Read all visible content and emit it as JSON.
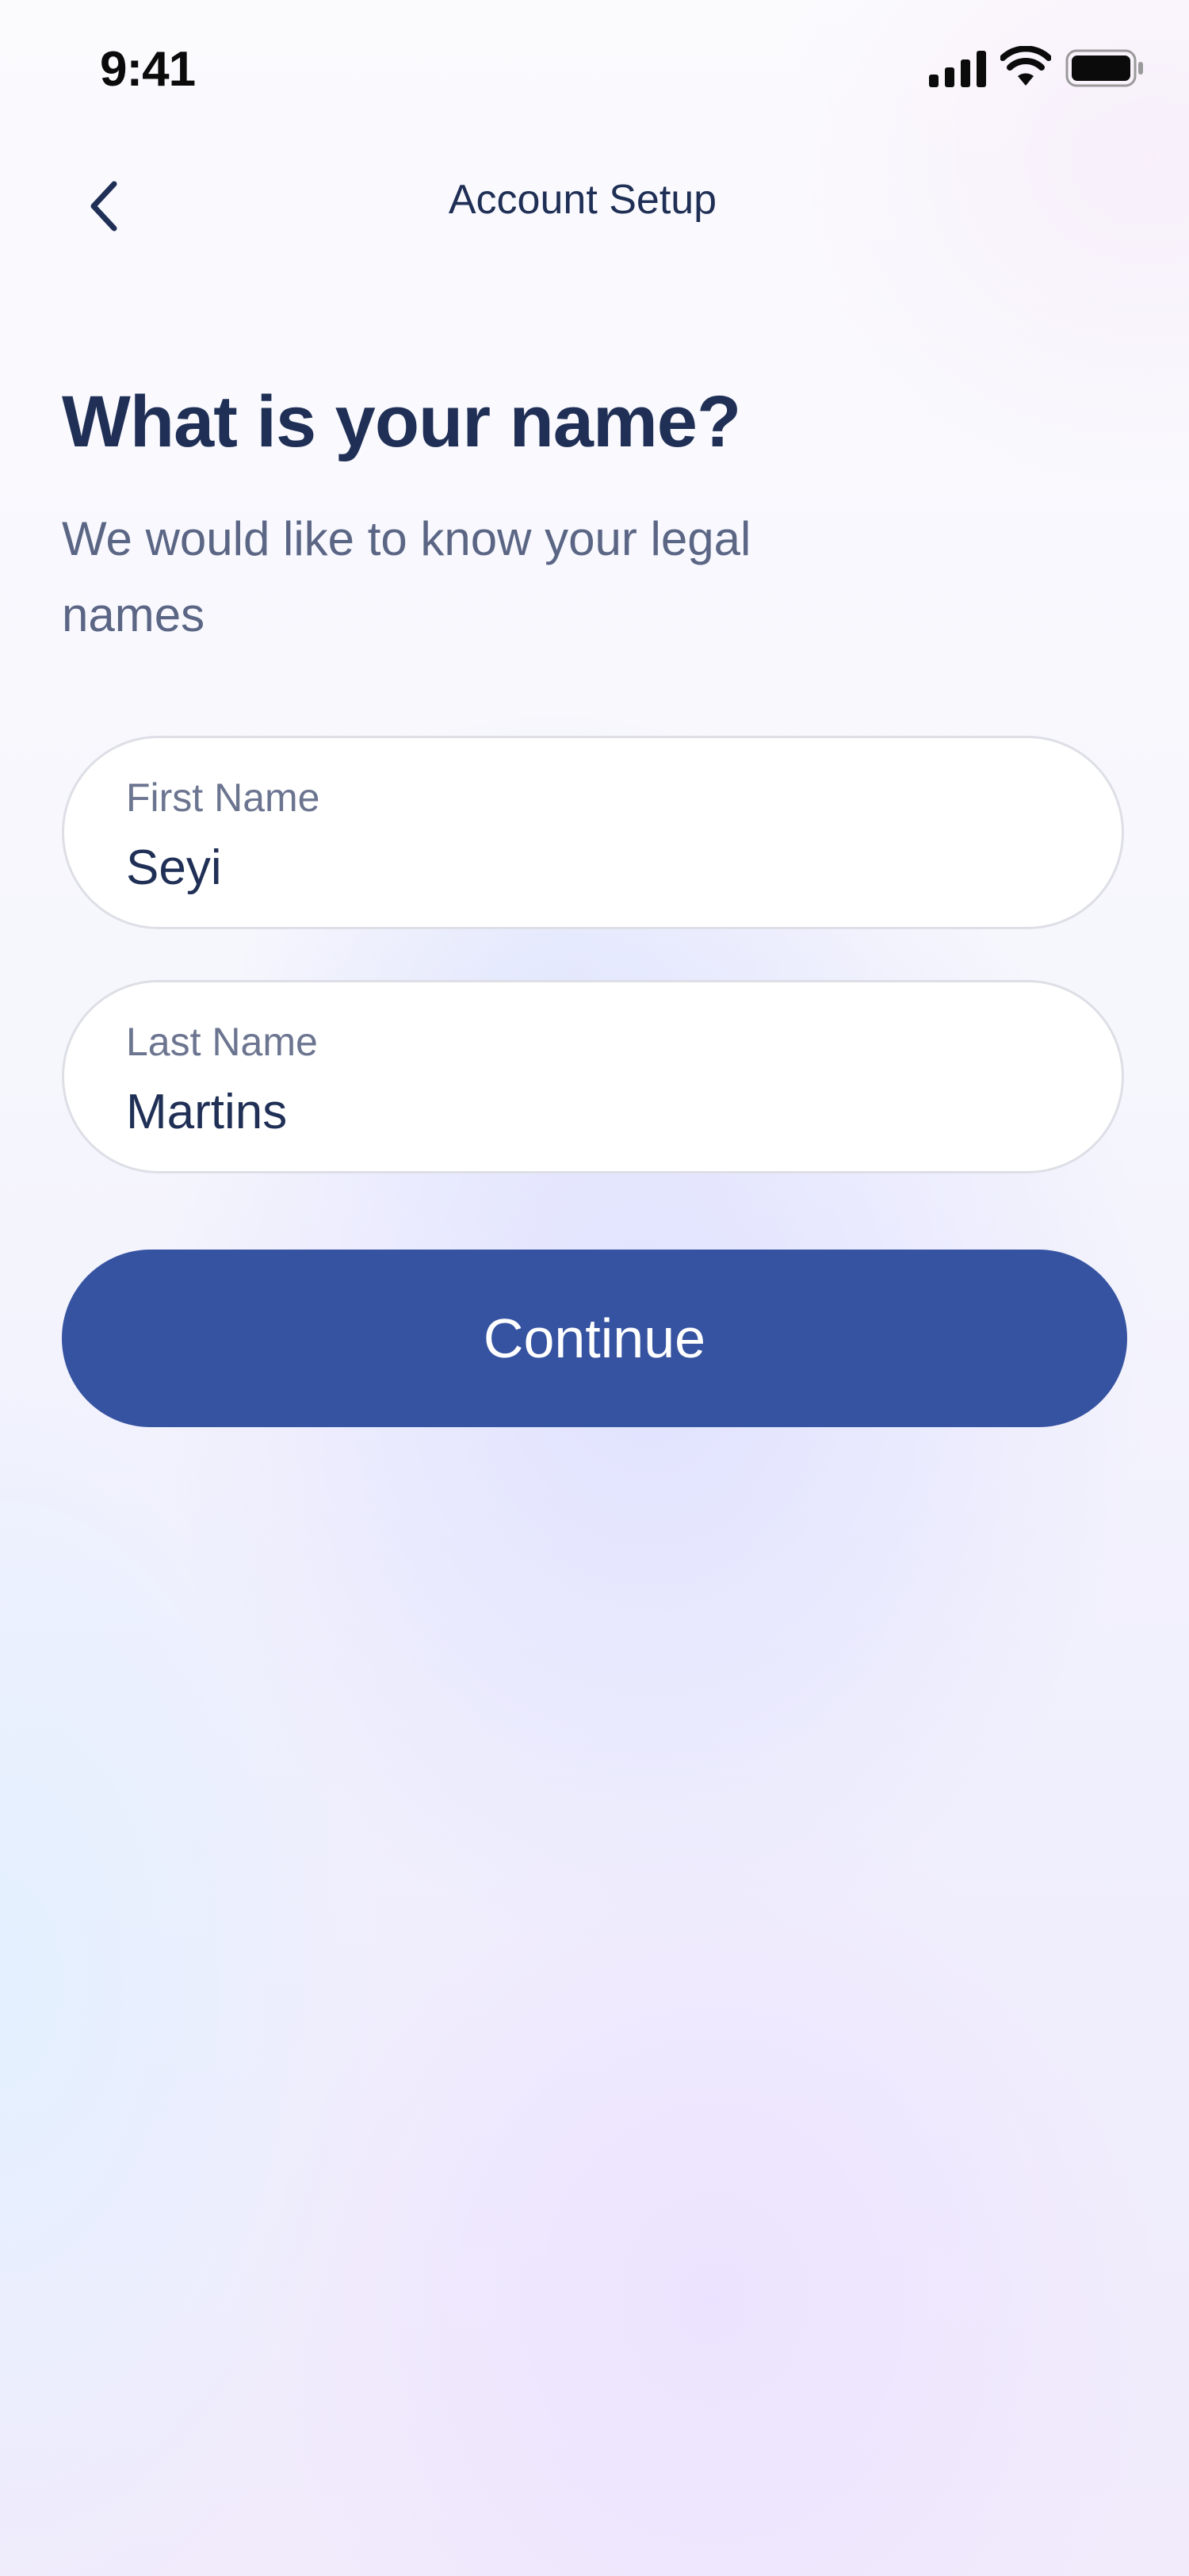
{
  "status_bar": {
    "time": "9:41",
    "icons": [
      "signal-icon",
      "wifi-icon",
      "battery-icon"
    ]
  },
  "nav": {
    "back_icon": "chevron-left-icon",
    "title": "Account Setup"
  },
  "main": {
    "title": "What is your name?",
    "subtitle": "We would like to know your legal names"
  },
  "form": {
    "first_name": {
      "label": "First Name",
      "value": "Seyi"
    },
    "last_name": {
      "label": "Last Name",
      "value": "Martins"
    }
  },
  "actions": {
    "continue_label": "Continue"
  },
  "colors": {
    "primary": "#3653a1",
    "text_dark": "#1f2f55",
    "text_muted": "#5b6685",
    "field_border": "#dedfe6"
  }
}
